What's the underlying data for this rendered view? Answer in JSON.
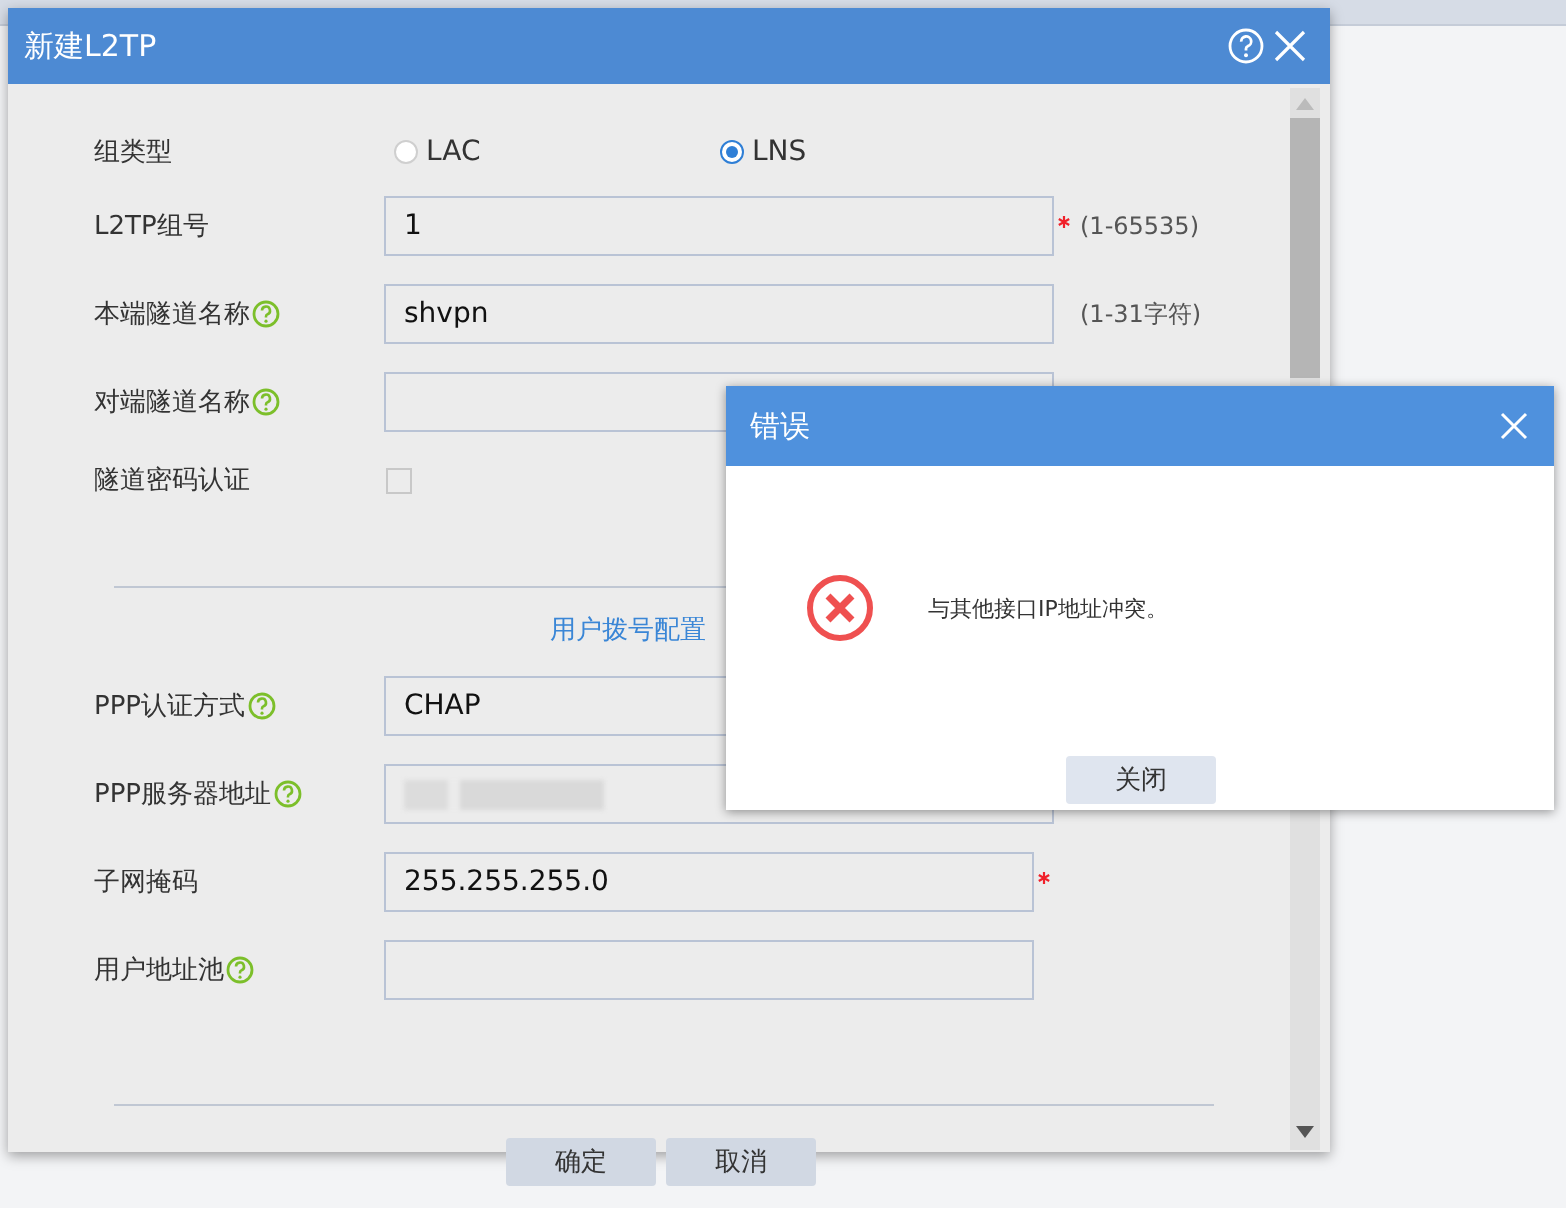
{
  "dialog": {
    "title": "新建L2TP"
  },
  "fields": [
    {
      "kind": "radio",
      "label": "组类型",
      "help": false,
      "options": [
        {
          "label": "LAC",
          "selected": false
        },
        {
          "label": "LNS",
          "selected": true
        }
      ]
    },
    {
      "kind": "input",
      "label": "L2TP组号",
      "help": false,
      "value": "1",
      "required": true,
      "hint": "(1-65535)"
    },
    {
      "kind": "input",
      "label": "本端隧道名称",
      "help": true,
      "value": "shvpn",
      "required": false,
      "hint": "(1-31字符)"
    },
    {
      "kind": "input",
      "label": "对端隧道名称",
      "help": true,
      "required": false
    },
    {
      "kind": "checkbox",
      "label": "隧道密码认证",
      "help": false,
      "checked": false
    }
  ],
  "section": {
    "title": "用户拨号配置"
  },
  "dial_fields": [
    {
      "kind": "input",
      "label": "PPP认证方式",
      "help": true,
      "value": "CHAP",
      "required": false
    },
    {
      "kind": "redacted",
      "label": "PPP服务器地址",
      "help": true,
      "required": false
    },
    {
      "kind": "input",
      "label": "子网掩码",
      "help": false,
      "value": "255.255.255.0",
      "required": true
    },
    {
      "kind": "input",
      "label": "用户地址池",
      "help": true,
      "required": false
    }
  ],
  "buttons": [
    "确定",
    "取消"
  ],
  "error": {
    "title": "错误",
    "message": "与其他接口IP地址冲突。",
    "button": "关闭"
  }
}
